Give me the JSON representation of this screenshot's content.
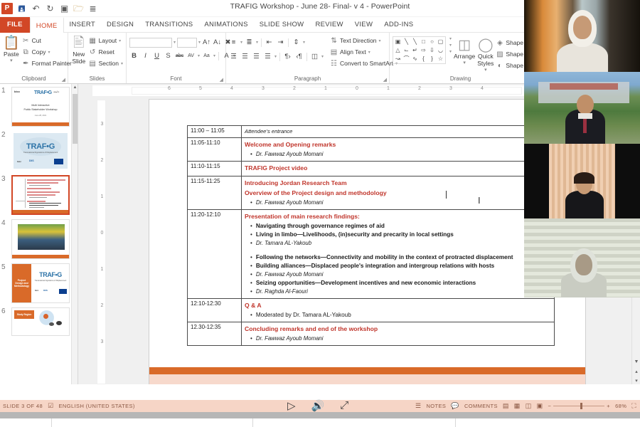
{
  "window": {
    "title": "TRAFIG Workshop - June 28- Final- v 4 - PowerPoint",
    "app_logo": "powerpoint-logo",
    "accent_color": "#D24726"
  },
  "quick_access": [
    {
      "name": "save-icon",
      "glyph": "▤"
    },
    {
      "name": "undo-icon",
      "glyph": "↶"
    },
    {
      "name": "redo-icon",
      "glyph": "↻"
    },
    {
      "name": "start-slideshow-icon",
      "glyph": "▣"
    },
    {
      "name": "open-icon",
      "glyph": "▰"
    },
    {
      "name": "customize-qat-icon",
      "glyph": "≡"
    }
  ],
  "tabs": [
    {
      "label": "FILE",
      "kind": "file"
    },
    {
      "label": "HOME",
      "kind": "active"
    },
    {
      "label": "INSERT",
      "kind": "normal"
    },
    {
      "label": "DESIGN",
      "kind": "normal"
    },
    {
      "label": "TRANSITIONS",
      "kind": "normal"
    },
    {
      "label": "ANIMATIONS",
      "kind": "normal"
    },
    {
      "label": "SLIDE SHOW",
      "kind": "normal"
    },
    {
      "label": "REVIEW",
      "kind": "normal"
    },
    {
      "label": "VIEW",
      "kind": "normal"
    },
    {
      "label": "ADD-INS",
      "kind": "normal"
    }
  ],
  "ribbon": {
    "clipboard": {
      "group_label": "Clipboard",
      "paste_label": "Paste",
      "items": [
        {
          "label": "Cut",
          "icon": "scissors-icon",
          "glyph": "✂"
        },
        {
          "label": "Copy",
          "icon": "copy-icon",
          "glyph": "⧉"
        },
        {
          "label": "Format Painter",
          "icon": "format-painter-icon",
          "glyph": "✎"
        }
      ]
    },
    "slides": {
      "group_label": "Slides",
      "new_slide_label": "New Slide",
      "items": [
        {
          "label": "Layout",
          "icon": "layout-icon",
          "glyph": "▦"
        },
        {
          "label": "Reset",
          "icon": "reset-icon",
          "glyph": "↺"
        },
        {
          "label": "Section",
          "icon": "section-icon",
          "glyph": "▤"
        }
      ]
    },
    "font": {
      "group_label": "Font",
      "font_name_value": "",
      "font_size_value": "",
      "buttons": [
        "A↑",
        "A↓",
        "⌫",
        "B",
        "I",
        "U",
        "S",
        "abc",
        "AV",
        "Aa",
        "A"
      ]
    },
    "paragraph": {
      "group_label": "Paragraph",
      "items": [
        {
          "label": "Text Direction",
          "icon": "text-direction-icon"
        },
        {
          "label": "Align Text",
          "icon": "align-text-icon"
        },
        {
          "label": "Convert to SmartArt",
          "icon": "smartart-icon"
        }
      ]
    },
    "drawing": {
      "group_label": "Drawing",
      "arrange_label": "Arrange",
      "quick_styles_label": "Quick Styles",
      "shape_buttons": [
        "Shape Fill",
        "Shape Outline",
        "Shape Effects"
      ],
      "shape_glyphs": [
        "▣",
        "╲",
        "╲",
        "□",
        "○",
        "▢",
        "△",
        "⌐",
        "↳",
        "⇨",
        "⇩",
        "◱",
        "⤳",
        "⌒",
        "∿",
        "{",
        "}",
        "☆"
      ]
    }
  },
  "slide_thumbnails": [
    {
      "number": "1",
      "selected": false,
      "kind": "title",
      "line1": "Multi Interactive",
      "line2": "Public Stakeholder Workshop",
      "line3": "June 28, 2021",
      "brand": "TRAF•G",
      "left_logo": "bicc"
    },
    {
      "number": "2",
      "selected": false,
      "kind": "logo",
      "brand": "TRAF•G",
      "subtitle": "Transnational Figurations of Displacement"
    },
    {
      "number": "3",
      "selected": true,
      "kind": "agenda"
    },
    {
      "number": "4",
      "selected": false,
      "kind": "photo"
    },
    {
      "number": "5",
      "selected": false,
      "kind": "section",
      "panel_text": "Project Design and Methodology",
      "brand": "TRAF•G",
      "subtitle": "Transnational Figurations of Displacement"
    },
    {
      "number": "6",
      "selected": false,
      "kind": "section",
      "panel_text": "Study Region"
    }
  ],
  "rulers": {
    "horizontal_ticks": [
      "6",
      "5",
      "4",
      "3",
      "2",
      "1",
      "0",
      "1",
      "2",
      "3",
      "4"
    ],
    "vertical_ticks": [
      "3",
      "2",
      "1",
      "0",
      "1",
      "2",
      "3"
    ]
  },
  "slide": {
    "agenda_rows": [
      {
        "time": "11:00 – 11:05",
        "blocks": [
          {
            "type": "italic",
            "text": "Attendee’s entrance"
          }
        ]
      },
      {
        "time": "11:05-11:10",
        "blocks": [
          {
            "type": "heading",
            "text": "Welcome and Opening remarks"
          },
          {
            "type": "bullet-name",
            "text": "Dr. Fawwaz Ayoub  Momani"
          }
        ]
      },
      {
        "time": "11:10-11:15",
        "blocks": [
          {
            "type": "heading",
            "text": "TRAFIG Project video"
          }
        ]
      },
      {
        "time": "11:15-11:25",
        "blocks": [
          {
            "type": "heading",
            "text": "Introducing Jordan Research Team"
          },
          {
            "type": "heading",
            "text": "Overview of the Project design and methodology"
          },
          {
            "type": "bullet-name",
            "text": "Dr. Fawwaz Ayoub  Momani"
          }
        ]
      },
      {
        "time": "11:20-12:10",
        "blocks": [
          {
            "type": "heading",
            "text": "Presentation of main research findings:"
          },
          {
            "type": "bullet",
            "text": "Navigating through governance regimes of aid"
          },
          {
            "type": "bullet",
            "text": "Living in limbo—Livelihoods, (in)security and precarity in local settings"
          },
          {
            "type": "bullet-name",
            "text": "Dr. Tamara AL-Yakoub"
          },
          {
            "type": "gap",
            "text": ""
          },
          {
            "type": "bullet",
            "text": "Following the networks—Connectivity and mobility in the context of protracted displacement"
          },
          {
            "type": "bullet",
            "text": "Building alliances—Displaced people's integration and intergroup relations with hosts"
          },
          {
            "type": "bullet-name",
            "text": "Dr. Fawwaz Ayoub  Momani"
          },
          {
            "type": "bullet",
            "text": "Seizing opportunities—Development incentives and new economic interactions"
          },
          {
            "type": "bullet-name",
            "text": "Dr. Raghda Al-Faouri"
          }
        ]
      },
      {
        "time": "12:10-12:30",
        "blocks": [
          {
            "type": "heading",
            "text": "Q & A"
          },
          {
            "type": "bullet",
            "text": "Moderated by Dr. Tamara AL-Yakoub"
          }
        ]
      },
      {
        "time": "12.30-12:35",
        "blocks": [
          {
            "type": "heading",
            "text": "Concluding remarks and end of the workshop"
          },
          {
            "type": "bullet-name",
            "text": "Dr. Fawwaz Ayoub  Momani"
          }
        ]
      }
    ]
  },
  "video_panel": {
    "tiles": [
      {
        "name": "participant-video-1",
        "description": "woman with white headscarf, sunset city backdrop"
      },
      {
        "name": "participant-video-2",
        "description": "man in dark suit with red tie, campus backdrop"
      },
      {
        "name": "participant-video-3",
        "description": "woman in black top, beige curtain backdrop"
      },
      {
        "name": "participant-video-4",
        "description": "woman with light headscarf, blinds backdrop"
      }
    ]
  },
  "status_bar": {
    "slide_counter": "SLIDE 3 OF 48",
    "language": "ENGLISH (UNITED STATES)",
    "spellcheck_icon": "spellcheck-icon",
    "notes_label": "NOTES",
    "comments_label": "COMMENTS",
    "zoom_level": "68%",
    "view_buttons": [
      "normal-view-icon",
      "slide-sorter-icon",
      "reading-view-icon",
      "slideshow-icon"
    ],
    "zoom_out_label": "−",
    "zoom_in_label": "+",
    "fit_icon": "fit-slide-icon"
  },
  "playback_controls": [
    {
      "name": "play-icon",
      "glyph": "▷"
    },
    {
      "name": "volume-icon",
      "glyph": "◁)"
    },
    {
      "name": "fullscreen-icon",
      "glyph": "⤢"
    }
  ]
}
